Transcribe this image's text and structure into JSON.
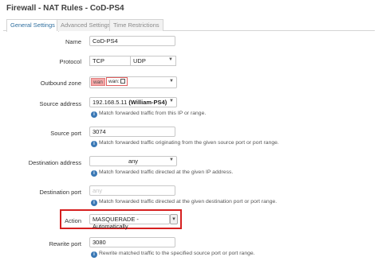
{
  "page": {
    "title": "Firewall - NAT Rules - CoD-PS4"
  },
  "tabs": [
    {
      "label": "General Settings",
      "active": true
    },
    {
      "label": "Advanced Settings",
      "active": false
    },
    {
      "label": "Time Restrictions",
      "active": false
    }
  ],
  "fields": {
    "name": {
      "label": "Name",
      "value": "CoD-PS4"
    },
    "protocol": {
      "label": "Protocol",
      "options_selected": [
        "TCP",
        "UDP"
      ]
    },
    "outbound_zone": {
      "label": "Outbound zone",
      "chip1": "wan",
      "chip2": "wan:"
    },
    "source_address": {
      "label": "Source address",
      "value": "192.168.5.11",
      "value_bold": "(William-PS4)",
      "hint": "Match forwarded traffic from this IP or range."
    },
    "source_port": {
      "label": "Source port",
      "value": "3074",
      "hint": "Match forwarded traffic originating from the given source port or port range."
    },
    "destination_address": {
      "label": "Destination address",
      "value": "any",
      "hint": "Match forwarded traffic directed at the given IP address."
    },
    "destination_port": {
      "label": "Destination port",
      "placeholder": "any",
      "hint": "Match forwarded traffic directed at the given destination port or port range."
    },
    "action": {
      "label": "Action",
      "value": "MASQUERADE - Automatically",
      "button": "▾"
    },
    "rewrite_port": {
      "label": "Rewrite port",
      "value": "3080",
      "hint": "Rewrite matched traffic to the specified source port or port range."
    }
  },
  "icons": {
    "info": "info-icon",
    "caret": "chevron-down-icon",
    "network": "network-icon"
  },
  "colors": {
    "highlight": "#d62020",
    "tab_active_text": "#2f6f9f",
    "info_icon": "#3a78b5",
    "zone_chip": "#f4a6a6"
  }
}
